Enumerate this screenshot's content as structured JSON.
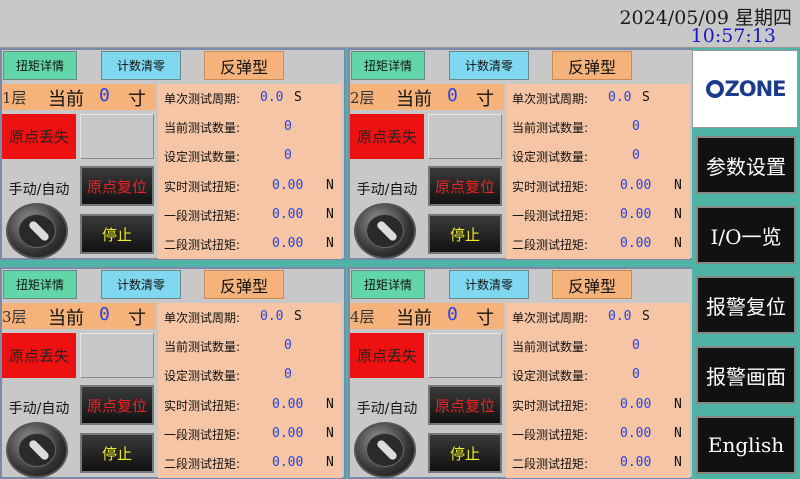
{
  "header": {
    "date": "2024/05/09 星期四",
    "time": "10:57:13"
  },
  "panel_labels": {
    "detail": "扭矩详情",
    "reset": "计数清零",
    "type": "反弹型",
    "current": "当前",
    "unit_cun": "寸",
    "origin_lost": "原点丢失",
    "manual_auto": "手动/自动",
    "origin_reset": "原点复位",
    "stop": "停止",
    "single_cycle": "单次测试周期:",
    "current_count": "当前测试数量:",
    "set_count": "设定测试数量:",
    "realtime_torque": "实时测试扭矩:",
    "stage1_torque": "一段测试扭矩:",
    "stage2_torque": "二段测试扭矩:",
    "unit_s": "S",
    "unit_n": "N"
  },
  "panels": [
    {
      "layer": "1层",
      "current": "0",
      "cycle": "0.0",
      "current_count": "0",
      "set_count": "0",
      "realtime": "0.00",
      "stage1": "0.00",
      "stage2": "0.00"
    },
    {
      "layer": "2层",
      "current": "0",
      "cycle": "0.0",
      "current_count": "0",
      "set_count": "0",
      "realtime": "0.00",
      "stage1": "0.00",
      "stage2": "0.00"
    },
    {
      "layer": "3层",
      "current": "0",
      "cycle": "0.0",
      "current_count": "0",
      "set_count": "0",
      "realtime": "0.00",
      "stage1": "0.00",
      "stage2": "0.00"
    },
    {
      "layer": "4层",
      "current": "0",
      "cycle": "0.0",
      "current_count": "0",
      "set_count": "0",
      "realtime": "0.00",
      "stage1": "0.00",
      "stage2": "0.00"
    }
  ],
  "sidebar": {
    "logo": "ZONE",
    "params": "参数设置",
    "io": "I/O一览",
    "alarm_reset": "报警复位",
    "alarm_screen": "报警画面",
    "english": "English"
  }
}
